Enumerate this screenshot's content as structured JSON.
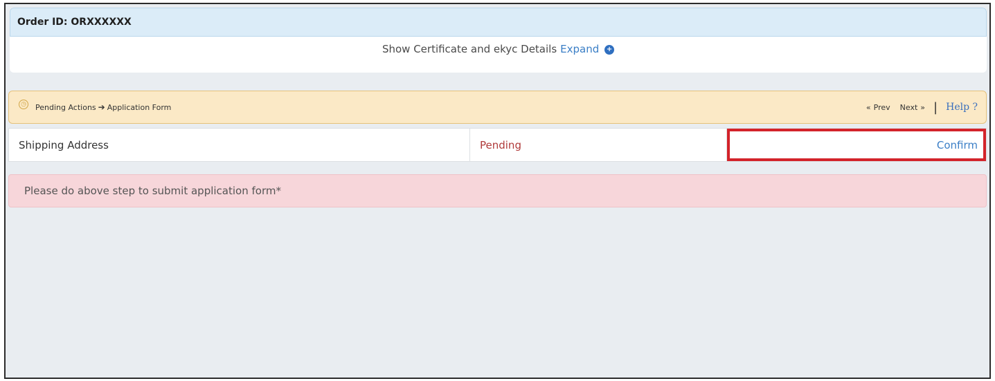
{
  "order": {
    "title": "Order ID: ORXXXXXX",
    "details_text": "Show Certificate and ekyc Details",
    "expand_label": "Expand",
    "expand_icon": "plus-circle-icon"
  },
  "breadcrumb": {
    "icon": "clock-icon",
    "parent": "Pending Actions",
    "arrow": "➔",
    "current": "Application Form"
  },
  "nav": {
    "prev_icon": "«",
    "prev_label": "Prev",
    "next_label": "Next",
    "next_icon": "»",
    "separator": "|",
    "help_label": "Help ?"
  },
  "step": {
    "name": "Shipping Address",
    "status": "Pending",
    "action": "Confirm"
  },
  "alert": {
    "message": "Please do above step to submit application form*"
  },
  "colors": {
    "link": "#3a7ec6",
    "pending": "#b03a3a",
    "highlight_border": "#d3232a",
    "breadcrumb_bg": "#fbe9c6",
    "alert_bg": "#f7d6da",
    "header_bg": "#dbecf8"
  }
}
